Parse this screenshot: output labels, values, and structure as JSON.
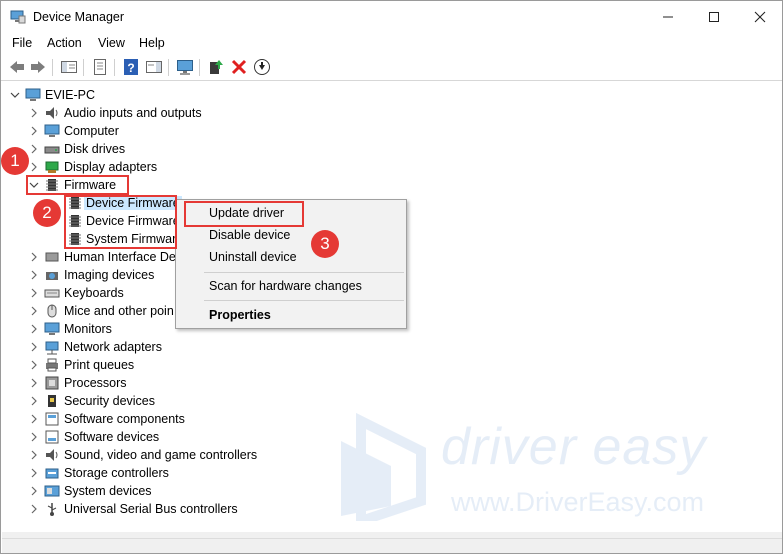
{
  "window": {
    "title": "Device Manager"
  },
  "menu": [
    "File",
    "Action",
    "View",
    "Help"
  ],
  "tree": {
    "root": "EVIE-PC",
    "categories": [
      "Audio inputs and outputs",
      "Computer",
      "Disk drives",
      "Display adapters",
      "Firmware",
      "Human Interface De",
      "Imaging devices",
      "Keyboards",
      "Mice and other poin",
      "Monitors",
      "Network adapters",
      "Print queues",
      "Processors",
      "Security devices",
      "Software components",
      "Software devices",
      "Sound, video and game controllers",
      "Storage controllers",
      "System devices",
      "Universal Serial Bus controllers"
    ],
    "firmware_children": [
      "Device Firmware",
      "Device Firmware",
      "System Firmware"
    ]
  },
  "context_menu": {
    "items": [
      "Update driver",
      "Disable device",
      "Uninstall device",
      "Scan for hardware changes",
      "Properties"
    ]
  },
  "annotations": [
    "1",
    "2",
    "3"
  ],
  "watermark": {
    "brand": "driver easy",
    "url": "www.DriverEasy.com"
  },
  "colors": {
    "annotation_red": "#e53935",
    "selection_blue": "#cce8ff",
    "watermark_blue": "#2f6fbf"
  }
}
